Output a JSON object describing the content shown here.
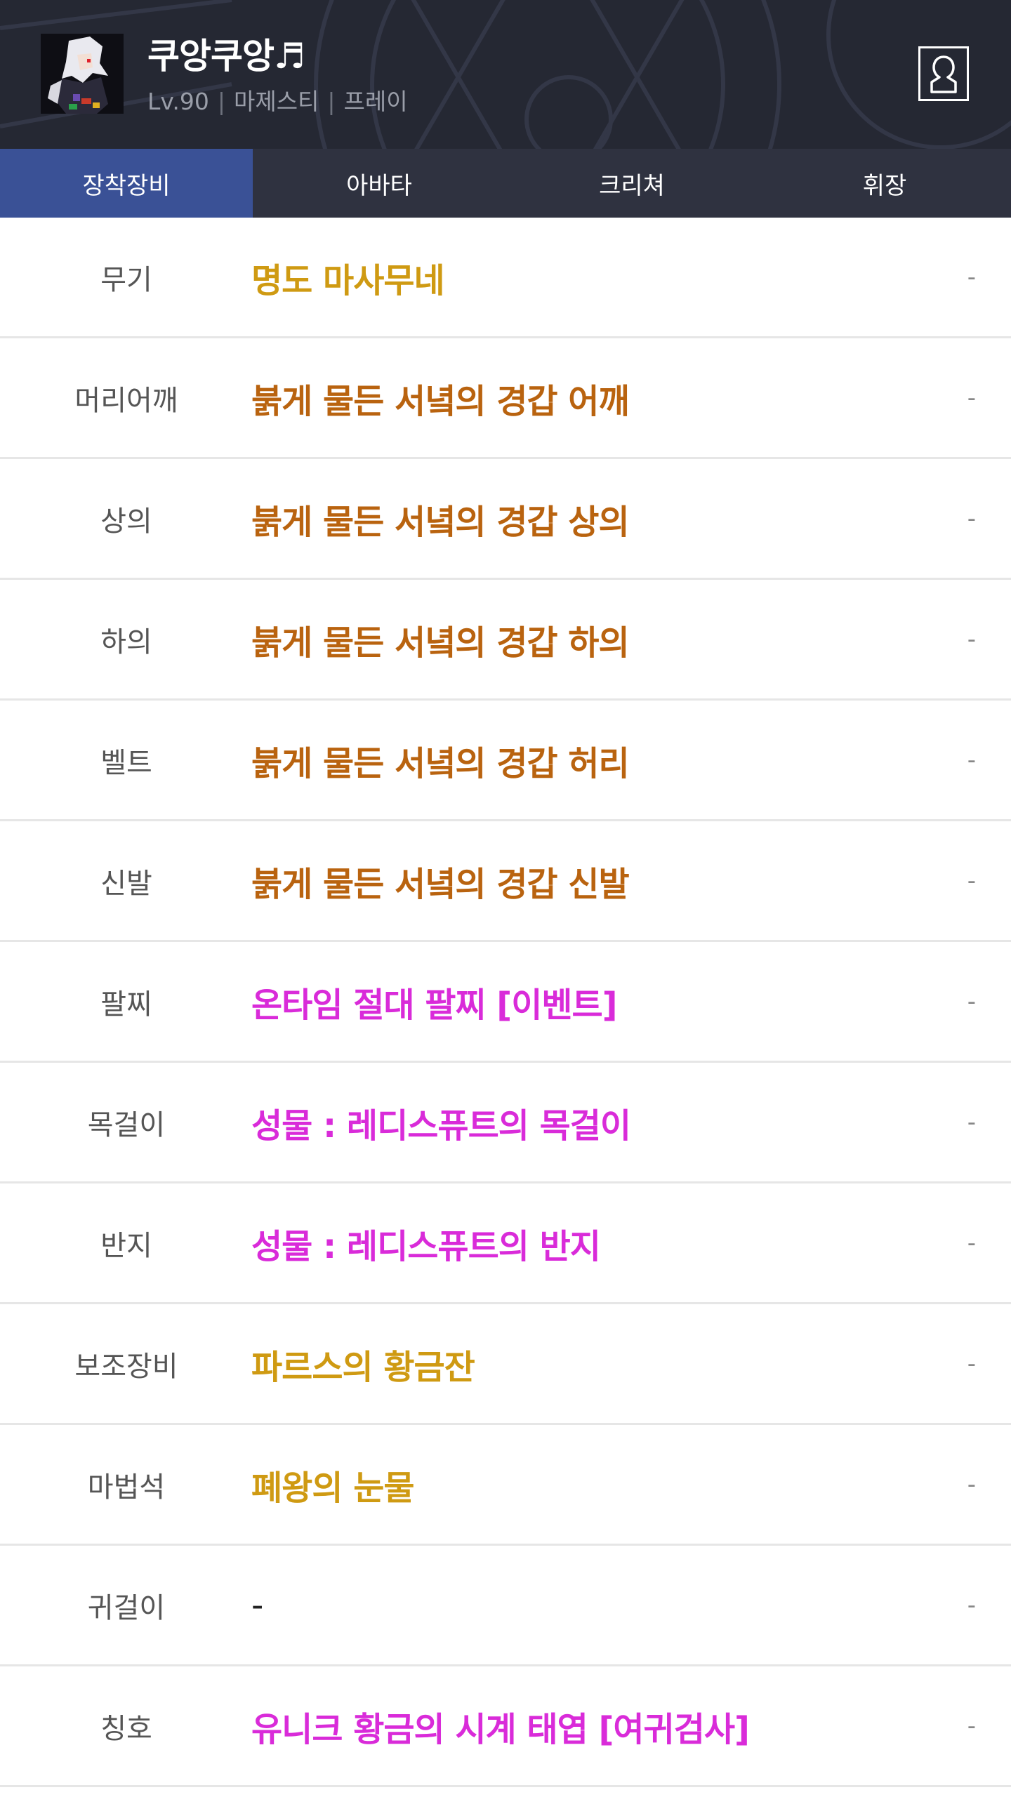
{
  "header": {
    "character_name": "쿠앙쿠앙♬",
    "level": "Lv.90",
    "job": "마제스티",
    "server": "프레이",
    "avatar_icon": "character-sprite",
    "profile_icon": "person-silhouette-icon"
  },
  "tabs": [
    {
      "label": "장착장비",
      "active": true
    },
    {
      "label": "아바타",
      "active": false
    },
    {
      "label": "크리쳐",
      "active": false
    },
    {
      "label": "휘장",
      "active": false
    }
  ],
  "colors": {
    "unique": "#cf9a12",
    "epic": "#b9630f",
    "legendary": "#d92bd9",
    "none": "#222222",
    "active_tab": "#3a5196",
    "tab_bar": "#2f3240",
    "header_bg": "#252833"
  },
  "equipment": [
    {
      "slot": "무기",
      "item": "명도 마사무네",
      "rarity": "unique",
      "extra": "-"
    },
    {
      "slot": "머리어깨",
      "item": "붉게 물든 서녘의 경갑 어깨",
      "rarity": "epic",
      "extra": "-"
    },
    {
      "slot": "상의",
      "item": "붉게 물든 서녘의 경갑 상의",
      "rarity": "epic",
      "extra": "-"
    },
    {
      "slot": "하의",
      "item": "붉게 물든 서녘의 경갑 하의",
      "rarity": "epic",
      "extra": "-"
    },
    {
      "slot": "벨트",
      "item": "붉게 물든 서녘의 경갑 허리",
      "rarity": "epic",
      "extra": "-"
    },
    {
      "slot": "신발",
      "item": "붉게 물든 서녘의 경갑 신발",
      "rarity": "epic",
      "extra": "-"
    },
    {
      "slot": "팔찌",
      "item": "온타임 절대 팔찌 [이벤트]",
      "rarity": "legendary",
      "extra": "-"
    },
    {
      "slot": "목걸이",
      "item": "성물 : 레디스퓨트의 목걸이",
      "rarity": "legendary",
      "extra": "-"
    },
    {
      "slot": "반지",
      "item": "성물 : 레디스퓨트의 반지",
      "rarity": "legendary",
      "extra": "-"
    },
    {
      "slot": "보조장비",
      "item": "파르스의 황금잔",
      "rarity": "unique",
      "extra": "-"
    },
    {
      "slot": "마법석",
      "item": "폐왕의 눈물",
      "rarity": "unique",
      "extra": "-"
    },
    {
      "slot": "귀걸이",
      "item": "-",
      "rarity": "none",
      "extra": "-"
    },
    {
      "slot": "칭호",
      "item": "유니크 황금의 시계 태엽  [여귀검사]",
      "rarity": "legendary",
      "extra": "-"
    }
  ]
}
